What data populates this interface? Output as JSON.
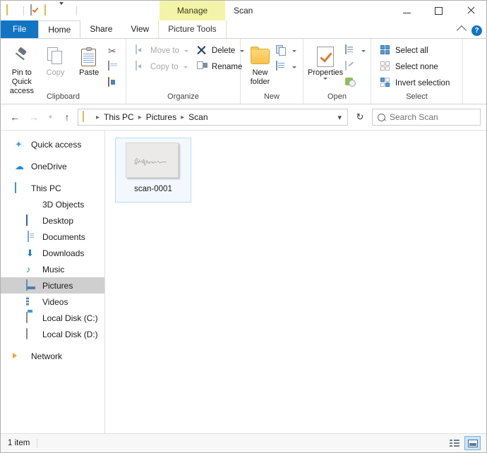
{
  "window": {
    "title": "Scan",
    "contextual_tab_group": "Manage",
    "quick_access": [
      {
        "name": "folder-icon",
        "label": "Properties / folder"
      },
      {
        "name": "properties-icon",
        "label": "Properties"
      },
      {
        "name": "new-folder-icon",
        "label": "New folder"
      },
      {
        "name": "customize-caret",
        "label": "Customize Quick Access Toolbar"
      }
    ],
    "controls": {
      "minimize": "Minimize",
      "maximize": "Maximize",
      "close": "Close",
      "collapse_ribbon": "Minimize the Ribbon",
      "help": "?"
    }
  },
  "tabs": [
    {
      "label": "File",
      "state": "file"
    },
    {
      "label": "Home",
      "state": "active"
    },
    {
      "label": "Share",
      "state": "normal"
    },
    {
      "label": "View",
      "state": "normal"
    },
    {
      "label": "Picture Tools",
      "state": "contextual"
    }
  ],
  "ribbon": {
    "groups": [
      {
        "label": "Clipboard",
        "big_buttons": [
          {
            "label": "Pin to Quick access",
            "icon": "pin-icon",
            "disabled": false
          },
          {
            "label": "Copy",
            "icon": "copy-icon",
            "disabled": true
          },
          {
            "label": "Paste",
            "icon": "paste-icon",
            "disabled": false
          }
        ],
        "small_buttons": [
          {
            "label": "Cut",
            "icon": "scissors-icon",
            "disabled": true,
            "show_label": false
          },
          {
            "label": "Copy path",
            "icon": "copy-path-icon",
            "disabled": true,
            "show_label": false
          },
          {
            "label": "Paste shortcut",
            "icon": "paste-shortcut-icon",
            "disabled": true,
            "show_label": false
          }
        ]
      },
      {
        "label": "Organize",
        "small_buttons": [
          {
            "label": "Move to",
            "icon": "move-to-icon",
            "disabled": true,
            "caret": true
          },
          {
            "label": "Copy to",
            "icon": "copy-to-icon",
            "disabled": true,
            "caret": true
          },
          {
            "label": "Delete",
            "icon": "delete-icon",
            "disabled": false,
            "caret": true
          },
          {
            "label": "Rename",
            "icon": "rename-icon",
            "disabled": false,
            "caret": false
          }
        ]
      },
      {
        "label": "New",
        "big_buttons": [
          {
            "label": "New folder",
            "icon": "new-folder-icon",
            "disabled": false
          }
        ],
        "small_buttons": [
          {
            "label": "New item",
            "icon": "new-item-icon",
            "disabled": false,
            "caret": true,
            "show_label": false
          },
          {
            "label": "Easy access",
            "icon": "easy-access-icon",
            "disabled": false,
            "caret": true,
            "show_label": false
          }
        ]
      },
      {
        "label": "Open",
        "big_buttons": [
          {
            "label": "Properties",
            "icon": "properties-icon",
            "disabled": false,
            "caret": true
          }
        ],
        "small_buttons": [
          {
            "label": "Open",
            "icon": "open-icon",
            "disabled": false,
            "caret": true,
            "show_label": false
          },
          {
            "label": "Edit",
            "icon": "edit-icon",
            "disabled": true,
            "show_label": false
          },
          {
            "label": "History",
            "icon": "history-icon",
            "disabled": false,
            "show_label": false
          }
        ]
      },
      {
        "label": "Select",
        "small_buttons": [
          {
            "label": "Select all",
            "icon": "select-all-icon",
            "disabled": false
          },
          {
            "label": "Select none",
            "icon": "select-none-icon",
            "disabled": false
          },
          {
            "label": "Invert selection",
            "icon": "invert-selection-icon",
            "disabled": false
          }
        ]
      }
    ]
  },
  "addressbar": {
    "back": "Back",
    "forward": "Forward",
    "recent": "Recent locations",
    "up": "Up to Pictures",
    "breadcrumbs": [
      "This PC",
      "Pictures",
      "Scan"
    ],
    "dropdown": "Previous locations",
    "refresh": "Refresh Scan"
  },
  "search": {
    "placeholder": "Search Scan",
    "value": ""
  },
  "sidebar": {
    "items": [
      {
        "label": "Quick access",
        "icon": "star-icon",
        "level": 0,
        "selected": false
      },
      {
        "label": "OneDrive",
        "icon": "cloud-icon",
        "level": 0,
        "selected": false
      },
      {
        "label": "This PC",
        "icon": "computer-icon",
        "level": 0,
        "selected": false
      },
      {
        "label": "3D Objects",
        "icon": "cube-icon",
        "level": 1,
        "selected": false
      },
      {
        "label": "Desktop",
        "icon": "desktop-icon",
        "level": 1,
        "selected": false
      },
      {
        "label": "Documents",
        "icon": "documents-icon",
        "level": 1,
        "selected": false
      },
      {
        "label": "Downloads",
        "icon": "download-icon",
        "level": 1,
        "selected": false
      },
      {
        "label": "Music",
        "icon": "music-note-icon",
        "level": 1,
        "selected": false
      },
      {
        "label": "Pictures",
        "icon": "pictures-icon",
        "level": 1,
        "selected": true
      },
      {
        "label": "Videos",
        "icon": "videos-icon",
        "level": 1,
        "selected": false
      },
      {
        "label": "Local Disk (C:)",
        "icon": "system-drive-icon",
        "level": 1,
        "selected": false
      },
      {
        "label": "Local Disk (D:)",
        "icon": "drive-icon",
        "level": 1,
        "selected": false
      },
      {
        "label": "Network",
        "icon": "network-icon",
        "level": 0,
        "selected": false
      }
    ]
  },
  "files": [
    {
      "name": "scan-0001",
      "icon": "image-thumbnail",
      "selected": true
    }
  ],
  "statusbar": {
    "item_count": "1 item",
    "views": [
      {
        "name": "details-view-button",
        "label": "Details",
        "active": false
      },
      {
        "name": "large-icons-view-button",
        "label": "Large icons",
        "active": true
      }
    ]
  },
  "colors": {
    "file_tab_blue": "#1275c4",
    "contextual_yellow": "#f4f4a8",
    "selection_blue": "#f2f8fd",
    "selection_border": "#bcdcf4",
    "sidebar_selected": "#cfcfcf",
    "folder_yellow": "#f7c04a"
  }
}
